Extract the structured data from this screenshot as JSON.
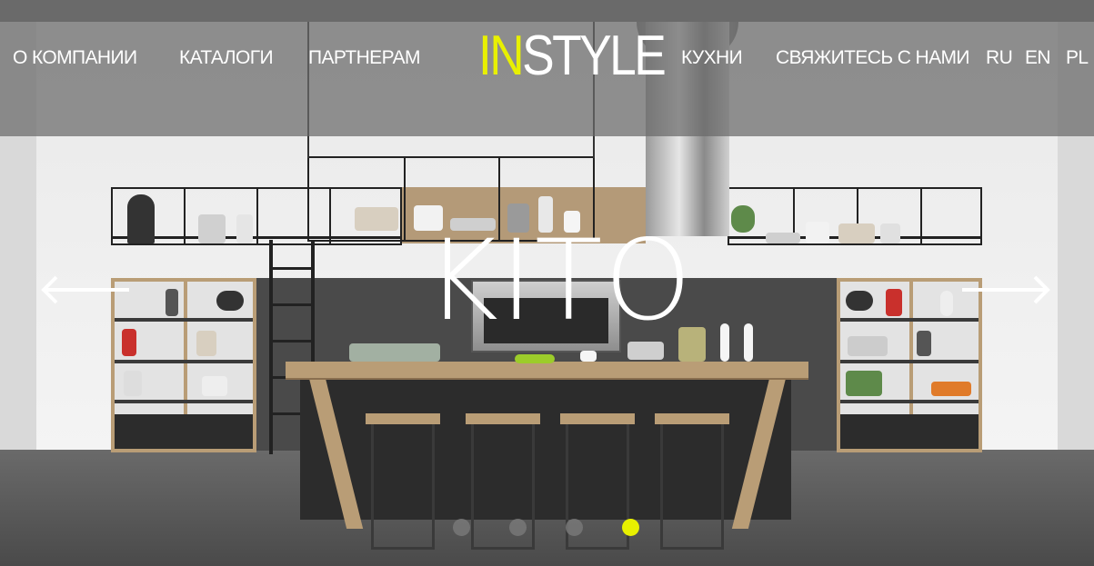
{
  "nav": {
    "left": [
      {
        "label": "О КОМПАНИИ"
      },
      {
        "label": "КАТАЛОГИ"
      },
      {
        "label": "ПАРТНЕРАМ"
      }
    ],
    "right": [
      {
        "label": "КУХНИ"
      },
      {
        "label": "СВЯЖИТЕСЬ С НАМИ"
      }
    ],
    "languages": [
      {
        "label": "RU"
      },
      {
        "label": "EN"
      },
      {
        "label": "PL"
      }
    ]
  },
  "logo": {
    "part1": "IN",
    "part2": "STYLE",
    "part1_color": "#e8f000",
    "part2_color": "#ffffff"
  },
  "slide": {
    "title": "KITO",
    "prev_icon": "arrow-left-icon",
    "next_icon": "arrow-right-icon"
  },
  "slider": {
    "total": 4,
    "active_index": 3,
    "active_color": "#e8f000"
  }
}
